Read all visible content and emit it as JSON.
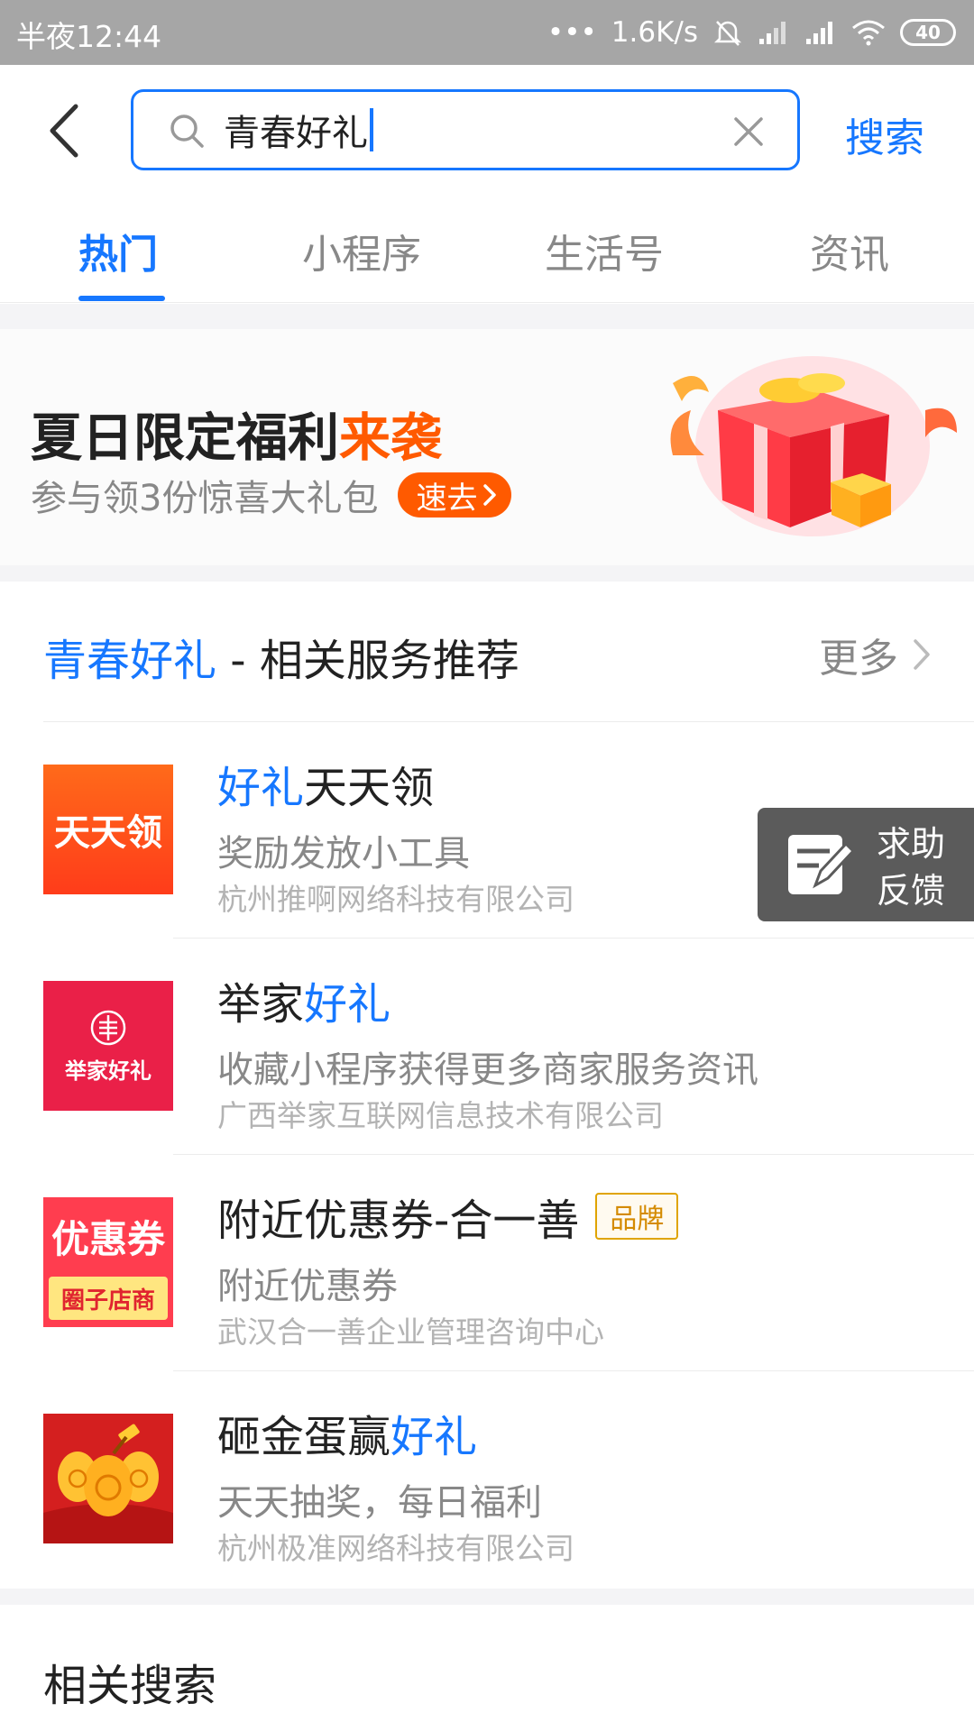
{
  "status_bar": {
    "time": "半夜12:44",
    "dots": "•••",
    "speed": "1.6K/s",
    "battery": "40"
  },
  "search": {
    "query": "青春好礼",
    "button_label": "搜索"
  },
  "tabs": [
    {
      "label": "热门",
      "active": true
    },
    {
      "label": "小程序",
      "active": false
    },
    {
      "label": "生活号",
      "active": false
    },
    {
      "label": "资讯",
      "active": false
    }
  ],
  "banner": {
    "title_main": "夏日限定福利",
    "title_highlight": "来袭",
    "subtitle": "参与领3份惊喜大礼包",
    "cta": "速去"
  },
  "section": {
    "keyword": "青春好礼",
    "title_rest": " - 相关服务推荐",
    "more": "更多"
  },
  "items": [
    {
      "name_kw": "好礼",
      "name_rest": "天天领",
      "desc": "奖励发放小工具",
      "company": "杭州推啊网络科技有限公司",
      "logo_text": "天天领"
    },
    {
      "name_pre": "举家",
      "name_kw": "好礼",
      "desc": "收藏小程序获得更多商家服务资讯",
      "company": "广西举家互联网信息技术有限公司",
      "logo_text": "举家好礼"
    },
    {
      "name": "附近优惠券-合一善",
      "badge": "品牌",
      "desc": "附近优惠券",
      "company": "武汉合一善企业管理咨询中心",
      "logo_top": "优惠券",
      "logo_bottom": "圈子店商"
    },
    {
      "name_pre": "砸金蛋赢",
      "name_kw": "好礼",
      "desc": "天天抽奖，每日福利",
      "company": "杭州极准网络科技有限公司"
    }
  ],
  "feedback": {
    "line1": "求助",
    "line2": "反馈"
  },
  "related_search": "相关搜索",
  "colors": {
    "accent": "#1677ff",
    "orange": "#ff5a00"
  }
}
